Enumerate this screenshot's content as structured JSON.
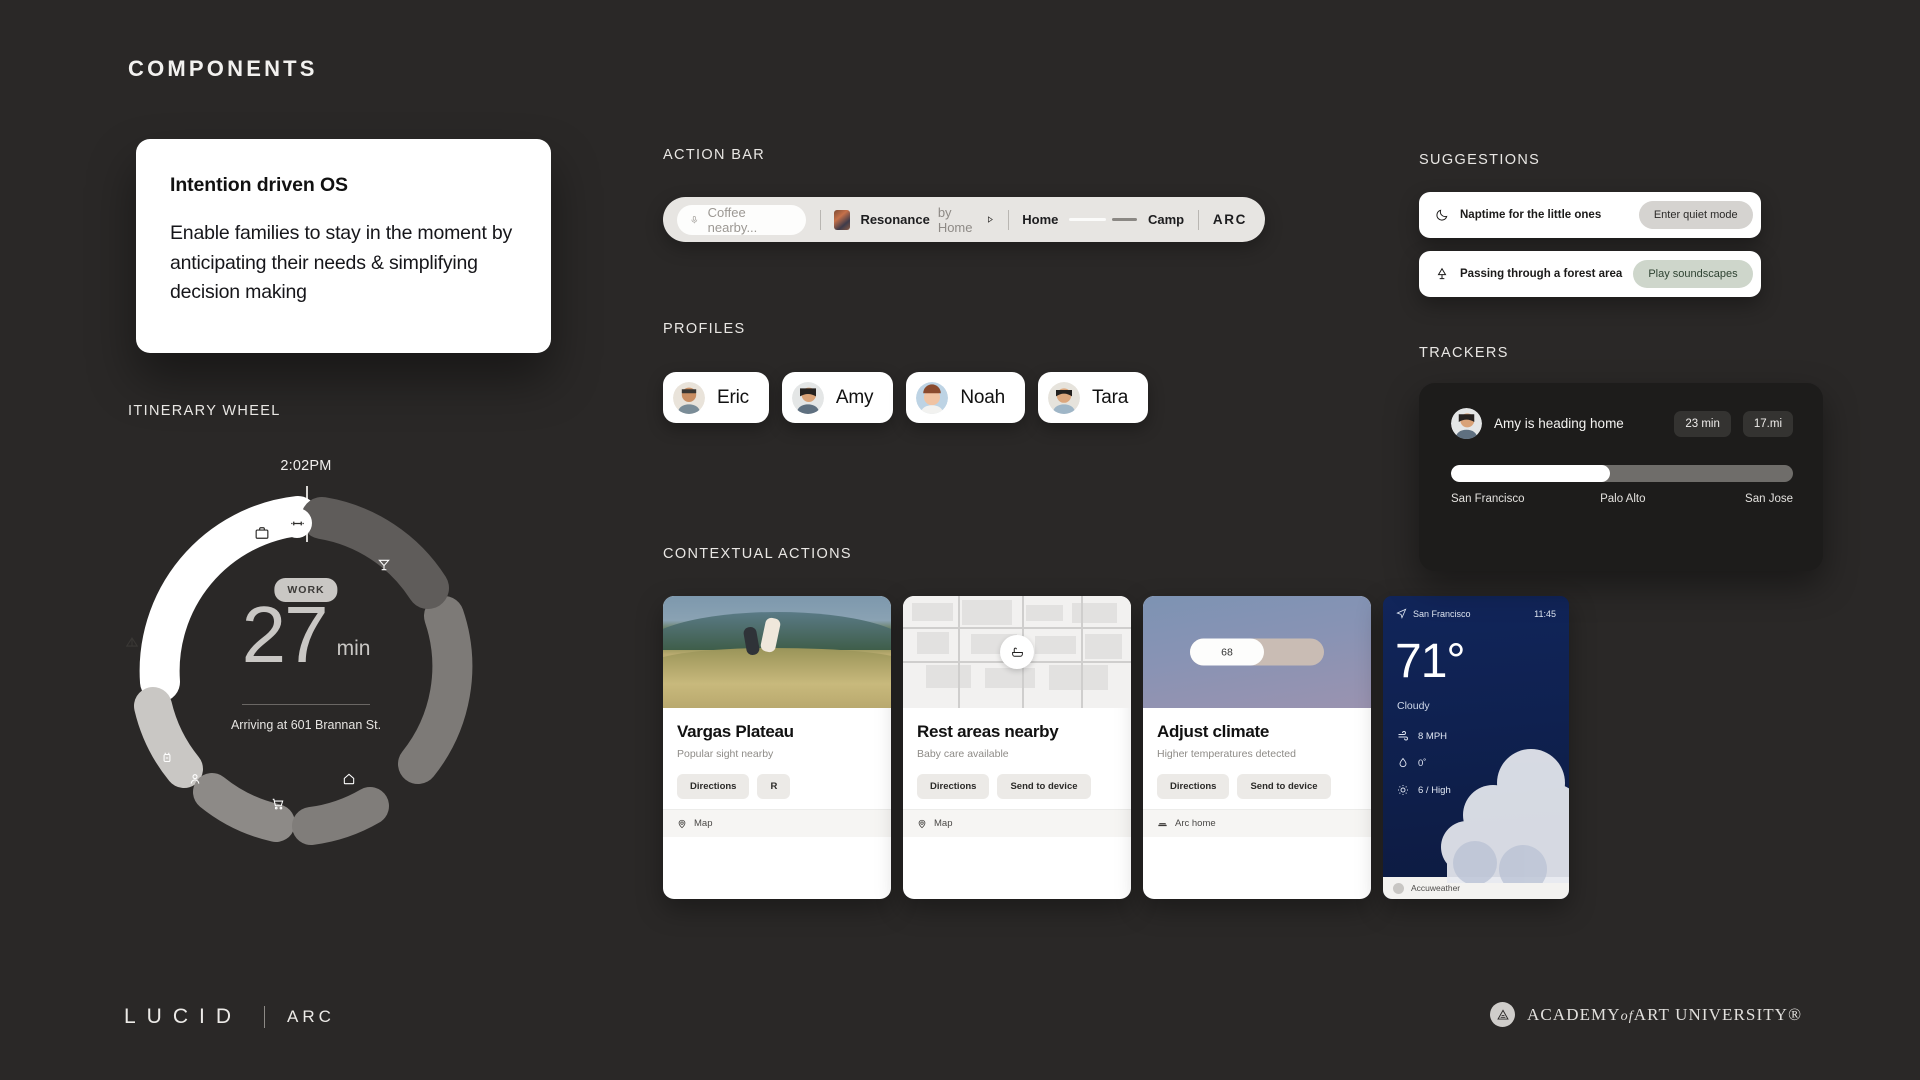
{
  "page": {
    "title": "COMPONENTS"
  },
  "hero": {
    "heading": "Intention driven OS",
    "body": "Enable families to stay in the moment by anticipating their needs & simplifying decision making"
  },
  "sections": {
    "itinerary": "ITINERARY WHEEL",
    "action_bar": "ACTION BAR",
    "profiles": "PROFILES",
    "contextual": "CONTEXTUAL ACTIONS",
    "suggestions": "SUGGESTIONS",
    "trackers": "TRACKERS"
  },
  "itinerary": {
    "time": "2:02PM",
    "badge": "WORK",
    "minutes": "27",
    "unit": "min",
    "arrival": "Arriving at 601 Brannan St.",
    "nodes": [
      {
        "icon": "briefcase-icon",
        "glyph": "💼"
      },
      {
        "icon": "dumbbell-icon",
        "glyph": "☲"
      },
      {
        "icon": "cocktail-icon",
        "glyph": "🍸"
      },
      {
        "icon": "tent-icon",
        "glyph": "⛺"
      },
      {
        "icon": "charger-icon",
        "glyph": "⛽"
      },
      {
        "icon": "person-icon",
        "glyph": "👤"
      },
      {
        "icon": "cart-icon",
        "glyph": "🛒"
      },
      {
        "icon": "home-icon",
        "glyph": "⌂"
      }
    ]
  },
  "action_bar": {
    "mic_icon": "microphone-icon",
    "search_placeholder": "Coffee nearby...",
    "album_art": "album-art-thumbnail",
    "track_title": "Resonance",
    "track_by": "by Home",
    "play_icon": "play-icon",
    "climate_left": "Home",
    "climate_right": "Camp",
    "slider_percent": 54,
    "brand": "ARC"
  },
  "profiles": [
    {
      "name": "Eric",
      "avatar": "avatar-eric"
    },
    {
      "name": "Amy",
      "avatar": "avatar-amy"
    },
    {
      "name": "Noah",
      "avatar": "avatar-noah"
    },
    {
      "name": "Tara",
      "avatar": "avatar-tara"
    }
  ],
  "contextual_cards": [
    {
      "media": "photo-field-running",
      "title": "Vargas Plateau",
      "subtitle": "Popular sight nearby",
      "primary_action": "Directions",
      "secondary_action": "R",
      "footer_icon": "map-pin-icon",
      "footer": "Map"
    },
    {
      "media": "map-tiles",
      "media_pin_icon": "bathtub-icon",
      "title": "Rest areas nearby",
      "subtitle": "Baby care available",
      "primary_action": "Directions",
      "secondary_action": "Send to device",
      "footer_icon": "map-pin-icon",
      "footer": "Map"
    },
    {
      "media": "climate-gradient",
      "media_value": "68",
      "title": "Adjust climate",
      "subtitle": "Higher temperatures detected",
      "primary_action": "Directions",
      "secondary_action": "Send to device",
      "footer_icon": "arc-home-icon",
      "footer": "Arc home"
    }
  ],
  "weather": {
    "location_icon": "navigation-arrow-icon",
    "location": "San Francisco",
    "time": "11:45",
    "temperature": "71°",
    "condition": "Cloudy",
    "stats": [
      {
        "icon": "wind-icon",
        "value": "8 MPH"
      },
      {
        "icon": "droplet-icon",
        "value": "0˚"
      },
      {
        "icon": "sun-icon",
        "value": "6 / High"
      }
    ],
    "provider_icon": "accuweather-icon",
    "provider": "Accuweather"
  },
  "suggestions": [
    {
      "icon": "moon-icon",
      "text": "Naptime for the little ones",
      "action": "Enter quiet mode",
      "action_style": "grey"
    },
    {
      "icon": "tree-icon",
      "text": "Passing through a forest area",
      "action": "Play soundscapes",
      "action_style": "green"
    }
  ],
  "tracker": {
    "avatar": "avatar-amy",
    "title": "Amy is heading home",
    "eta": "23 min",
    "distance": "17.mi",
    "progress_percent": 46.5,
    "stops": [
      "San Francisco",
      "Palo Alto",
      "San Jose"
    ]
  },
  "footer": {
    "lucid": "LUCID",
    "arc": "ARC",
    "academy_mark": "academy-triangle-icon",
    "academy_a": "ACADEMY",
    "academy_of": "of",
    "academy_b": "ART UNIVERSITY®"
  },
  "colors": {
    "background": "#2a2827",
    "card": "#ffffff",
    "tracker_panel": "#1d1c1b",
    "accent_green": "#ced6cb",
    "weather_sky": "#11255a"
  }
}
